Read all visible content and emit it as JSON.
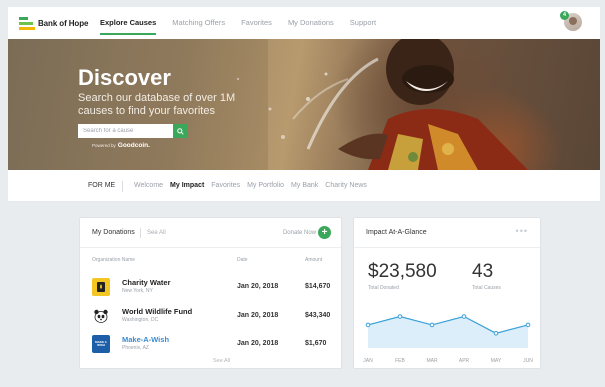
{
  "brand": {
    "name": "Bank of Hope"
  },
  "nav": {
    "tabs": [
      {
        "label": "Explore Causes",
        "active": true
      },
      {
        "label": "Matching Offers",
        "active": false
      },
      {
        "label": "Favorites",
        "active": false
      },
      {
        "label": "My Donations",
        "active": false
      },
      {
        "label": "Support",
        "active": false
      }
    ],
    "notification_count": "4"
  },
  "hero": {
    "title": "Discover",
    "subtitle": "Search our database of over 1M causes to find your favorites",
    "search_placeholder": "Search for a cause",
    "powered_by_prefix": "Powered by",
    "powered_by_brand": "Goodcoin."
  },
  "subnav": {
    "section_label": "FOR ME",
    "tabs": [
      {
        "label": "Welcome",
        "active": false
      },
      {
        "label": "My Impact",
        "active": true
      },
      {
        "label": "Favorites",
        "active": false
      },
      {
        "label": "My Portfolio",
        "active": false
      },
      {
        "label": "My Bank",
        "active": false
      },
      {
        "label": "Charity News",
        "active": false
      }
    ]
  },
  "donations": {
    "title": "My Donations",
    "see_all": "See All",
    "donate_now": "Donate Now",
    "columns": {
      "org": "Organization Name",
      "date": "Date",
      "amount": "Amount"
    },
    "rows": [
      {
        "name": "Charity Water",
        "location": "New York, NY",
        "date": "Jan 20, 2018",
        "amount": "$14,670"
      },
      {
        "name": "World Wildlife Fund",
        "location": "Washington, DC",
        "date": "Jan 20, 2018",
        "amount": "$43,340"
      },
      {
        "name": "Make-A-Wish",
        "location": "Phoenix, AZ",
        "date": "Jan 20, 2018",
        "amount": "$1,670"
      }
    ],
    "logos": [
      {
        "icon": "charity-water-logo",
        "bg": "#f3c623"
      },
      {
        "icon": "panda-logo",
        "bg": "#ffffff"
      },
      {
        "icon": "make-a-wish-logo",
        "bg": "#1d5ea8"
      }
    ],
    "make_a_wish_logo_text": "MAKE A WISH"
  },
  "impact": {
    "title": "Impact At-A-Glance",
    "total_donated": "$23,580",
    "total_donated_label": "Total Donated",
    "total_causes": "43",
    "total_causes_label": "Total Causes"
  },
  "chart_data": {
    "type": "area",
    "categories": [
      "JAN",
      "FEB",
      "MAR",
      "APR",
      "MAY",
      "JUN"
    ],
    "values": [
      0.55,
      0.75,
      0.55,
      0.75,
      0.35,
      0.55
    ],
    "line_color": "#3aa0d8",
    "fill_color": "#dbeef9"
  },
  "colors": {
    "accent": "#3ba75a",
    "link": "#3b8bd1"
  }
}
